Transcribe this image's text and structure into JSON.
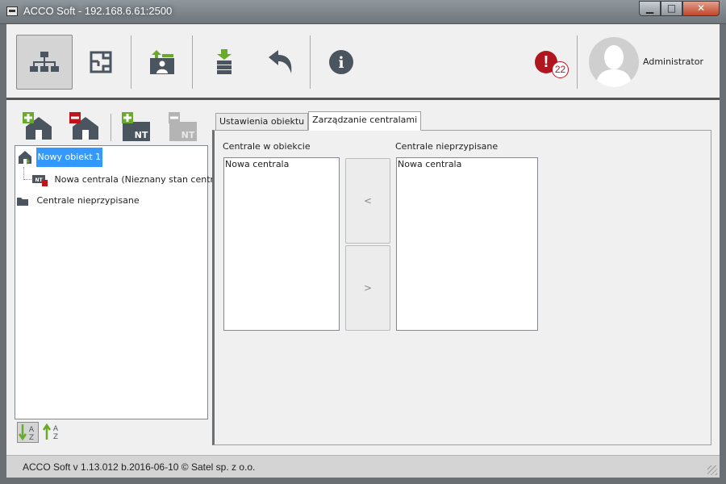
{
  "window": {
    "title": "ACCO Soft - 192.168.6.61:2500",
    "minimize": "▁",
    "maximize": "□",
    "close": "✕"
  },
  "toolbar": {
    "icons": [
      "structure-icon",
      "floorplan-icon",
      "upload-to-panel-icon",
      "download-from-panel-icon",
      "undo-icon",
      "info-icon"
    ],
    "alarm_symbol": "!",
    "alarm_count": "22",
    "user_name": "Administrator",
    "info_glyph": "i"
  },
  "tree": {
    "object_label": "Nowy obiekt 1",
    "central_label": "Nowa centrala (Nieznany stan centrali)",
    "unassigned_label": "Centrale nieprzypisane",
    "nt_badge": "NT"
  },
  "tabs": [
    {
      "label": "Ustawienia obiektu"
    },
    {
      "label": "Zarządzanie centralami"
    }
  ],
  "management": {
    "assigned_label": "Centrale w obiekcie",
    "unassigned_label": "Centrale nieprzypisane",
    "assigned_items": [
      "Nowa centrala"
    ],
    "unassigned_items": [
      "Nowa centrala"
    ],
    "move_left": "<",
    "move_right": ">"
  },
  "status": {
    "text": "ACCO Soft v 1.13.012 b.2016-06-10   © Satel sp. z o.o."
  },
  "colors": {
    "accent_green": "#6aaa2a",
    "icon_dark": "#4a5560",
    "alarm_red": "#b0161f",
    "selection_blue": "#3399ff"
  }
}
